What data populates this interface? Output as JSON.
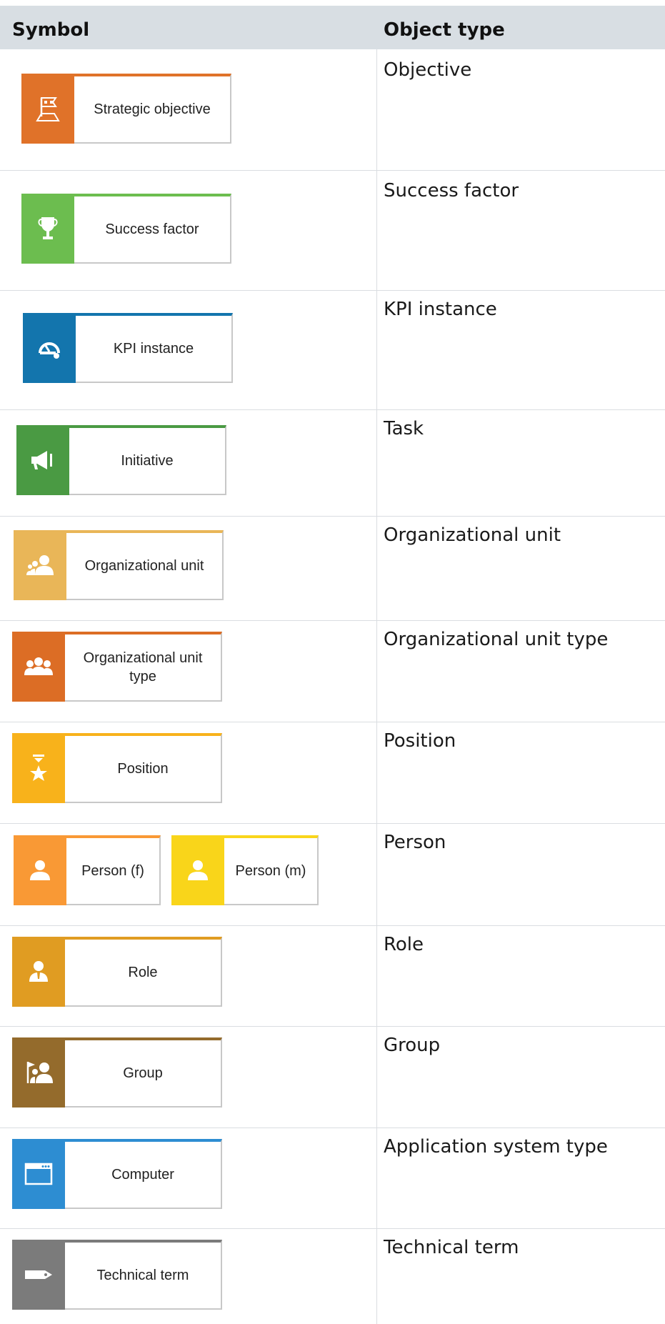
{
  "header": {
    "symbol": "Symbol",
    "object_type": "Object type"
  },
  "rows": [
    {
      "type": "Objective",
      "symbols": [
        {
          "label": "Strategic objective",
          "color": "#e07229",
          "icon": "flag-icon"
        }
      ]
    },
    {
      "type": "Success factor",
      "symbols": [
        {
          "label": "Success factor",
          "color": "#6cbd4f",
          "icon": "trophy-icon"
        }
      ]
    },
    {
      "type": "KPI instance",
      "symbols": [
        {
          "label": "KPI instance",
          "color": "#1375ad",
          "icon": "gauge-icon"
        }
      ]
    },
    {
      "type": "Task",
      "symbols": [
        {
          "label": "Initiative",
          "color": "#4a9a43",
          "icon": "megaphone-icon"
        }
      ]
    },
    {
      "type": "Organizational unit",
      "symbols": [
        {
          "label": "Organizational unit",
          "color": "#e9b658",
          "icon": "people-icon"
        }
      ]
    },
    {
      "type": "Organizational unit type",
      "symbols": [
        {
          "label": "Organizational unit type",
          "color": "#dc6d25",
          "icon": "group-icon"
        }
      ]
    },
    {
      "type": "Position",
      "symbols": [
        {
          "label": "Position",
          "color": "#f8b21b",
          "icon": "star-icon"
        }
      ]
    },
    {
      "type": "Person",
      "symbols": [
        {
          "label": "Person (f)",
          "color": "#f99935",
          "icon": "person-icon"
        },
        {
          "label": "Person (m)",
          "color": "#f9d51a",
          "icon": "person-icon"
        }
      ]
    },
    {
      "type": "Role",
      "symbols": [
        {
          "label": "Role",
          "color": "#e09c22",
          "icon": "role-icon"
        }
      ]
    },
    {
      "type": "Group",
      "symbols": [
        {
          "label": "Group",
          "color": "#946b2c",
          "icon": "group-flag-icon"
        }
      ]
    },
    {
      "type": "Application system type",
      "symbols": [
        {
          "label": "Computer",
          "color": "#2d8dd2",
          "icon": "window-icon"
        }
      ]
    },
    {
      "type": "Technical term",
      "symbols": [
        {
          "label": "Technical term",
          "color": "#7b7b7b",
          "icon": "tag-icon"
        }
      ]
    }
  ]
}
